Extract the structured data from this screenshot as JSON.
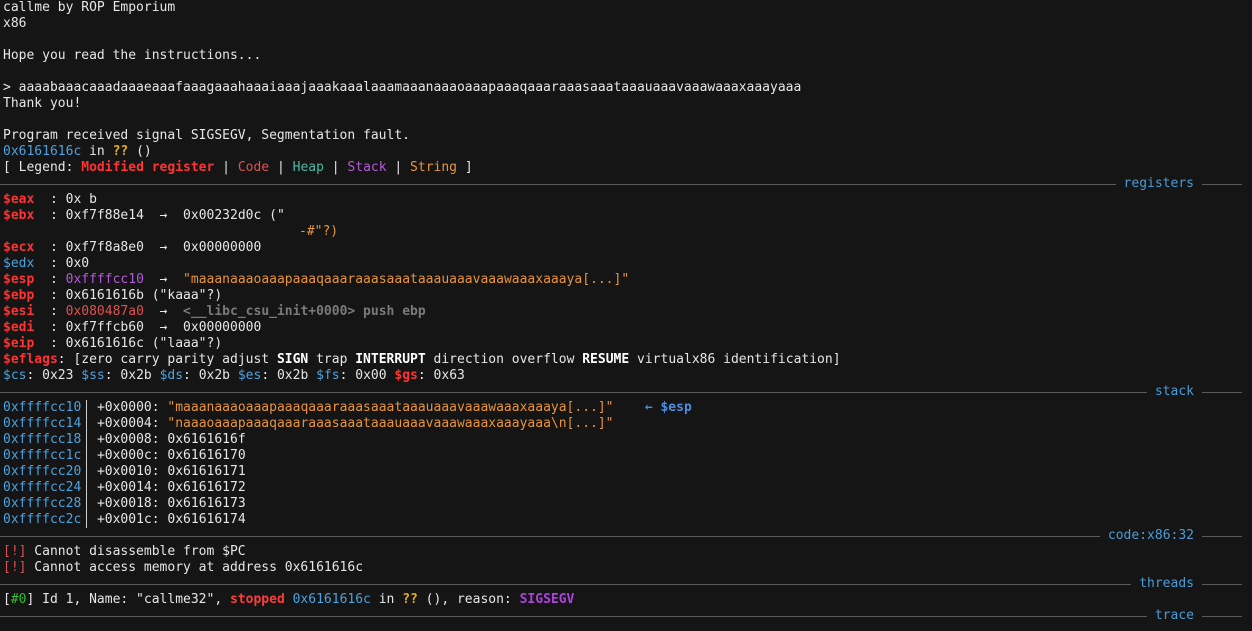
{
  "header": {
    "title": "callme by ROP Emporium",
    "arch": "x86",
    "hope": "Hope you read the instructions...",
    "input_line": "> aaaabaaacaaadaaaeaaafaaagaaahaaaiaaajaaakaaalaaamaaanaaaoaaapaaaqaaaraaasaaataaauaaavaaawaaaxaaayaaa",
    "thanks": "Thank you!",
    "signal": "Program received signal SIGSEGV, Segmentation fault.",
    "fault_addr": "0x6161616c",
    "fault_in": " in ",
    "fault_func": "??",
    "fault_paren": " ()"
  },
  "legend": {
    "open": "[ Legend: ",
    "modified": "Modified register",
    "sep": " | ",
    "code": "Code",
    "heap": "Heap",
    "stack": "Stack",
    "string": "String",
    "close": " ]"
  },
  "sections": {
    "registers": "registers",
    "stack": "stack",
    "code": "code:x86:32",
    "threads": "threads",
    "trace": "trace"
  },
  "registers": {
    "eax": {
      "name": "$eax",
      "sep": "  : ",
      "value": "0x b"
    },
    "ebx": {
      "name": "$ebx",
      "sep": "  : ",
      "value": "0xf7f88e14",
      "arrow": "  →  ",
      "target": "0x00232d0c (\"",
      "cont": "-#\"?)"
    },
    "ecx": {
      "name": "$ecx",
      "sep": "  : ",
      "value": "0xf7f8a8e0",
      "arrow": "  →  ",
      "target": "0x00000000"
    },
    "edx": {
      "name": "$edx",
      "sep": "  : ",
      "value": "0x0"
    },
    "esp": {
      "name": "$esp",
      "sep": "  : ",
      "value": "0xffffcc10",
      "arrow": "  →  ",
      "target": "\"maaanaaaoaaapaaaqaaaraaasaaataaauaaavaaawaaaxaaaya[...]\""
    },
    "ebp": {
      "name": "$ebp",
      "sep": "  : ",
      "value": "0x6161616b (\"kaaa\"?)"
    },
    "esi": {
      "name": "$esi",
      "sep": "  : ",
      "value": "0x080487a0",
      "arrow": "  →  ",
      "target": "<__libc_csu_init+0000> push ebp"
    },
    "edi": {
      "name": "$edi",
      "sep": "  : ",
      "value": "0xf7ffcb60",
      "arrow": "  →  ",
      "target": "0x00000000"
    },
    "eip": {
      "name": "$eip",
      "sep": "  : ",
      "value": "0x6161616c (\"laaa\"?)"
    },
    "eflags": {
      "name": "$eflags",
      "sep": ": ",
      "open": "[zero carry parity adjust ",
      "sign": "SIGN",
      "mid1": " trap ",
      "interrupt": "INTERRUPT",
      "mid2": " direction overflow ",
      "resume": "RESUME",
      "close": " virtualx86 identification]"
    },
    "segments": [
      {
        "name": "$cs",
        "value": ": 0x23 "
      },
      {
        "name": "$ss",
        "value": ": 0x2b "
      },
      {
        "name": "$ds",
        "value": ": 0x2b "
      },
      {
        "name": "$es",
        "value": ": 0x2b "
      },
      {
        "name": "$fs",
        "value": ": 0x00 "
      },
      {
        "name": "$gs",
        "value": ": 0x63"
      }
    ]
  },
  "stack": [
    {
      "addr": "0xffffcc10",
      "off": "+0x0000: ",
      "value": "\"maaanaaaoaaapaaaqaaaraaasaaataaauaaavaaawaaaxaaaya[...]\"",
      "tag": "← $esp"
    },
    {
      "addr": "0xffffcc14",
      "off": "+0x0004: ",
      "value": "\"naaaoaaapaaaqaaaraaasaaataaauaaavaaawaaaxaaayaaa\\n[...]\""
    },
    {
      "addr": "0xffffcc18",
      "off": "+0x0008: ",
      "value": "0x6161616f"
    },
    {
      "addr": "0xffffcc1c",
      "off": "+0x000c: ",
      "value": "0x61616170"
    },
    {
      "addr": "0xffffcc20",
      "off": "+0x0010: ",
      "value": "0x61616171"
    },
    {
      "addr": "0xffffcc24",
      "off": "+0x0014: ",
      "value": "0x61616172"
    },
    {
      "addr": "0xffffcc28",
      "off": "+0x0018: ",
      "value": "0x61616173"
    },
    {
      "addr": "0xffffcc2c",
      "off": "+0x001c: ",
      "value": "0x61616174"
    }
  ],
  "code": [
    {
      "tag": "[!]",
      "msg": " Cannot disassemble from $PC"
    },
    {
      "tag": "[!]",
      "msg": " Cannot access memory at address 0x6161616c"
    }
  ],
  "thread": {
    "open": "[",
    "id": "#0",
    "mid": "] Id 1, Name: \"callme32\", ",
    "status": "stopped",
    "addr": " 0x6161616c",
    "in": " in ",
    "func": "??",
    "reason_label": " (), reason: ",
    "reason": "SIGSEGV"
  },
  "colors": {
    "background": "#151516",
    "modified": "#ff3333",
    "code": "#e05050",
    "heap": "#4bb8a8",
    "stack": "#b35ad9",
    "string": "#e8943a",
    "section": "#4a9bd6"
  }
}
